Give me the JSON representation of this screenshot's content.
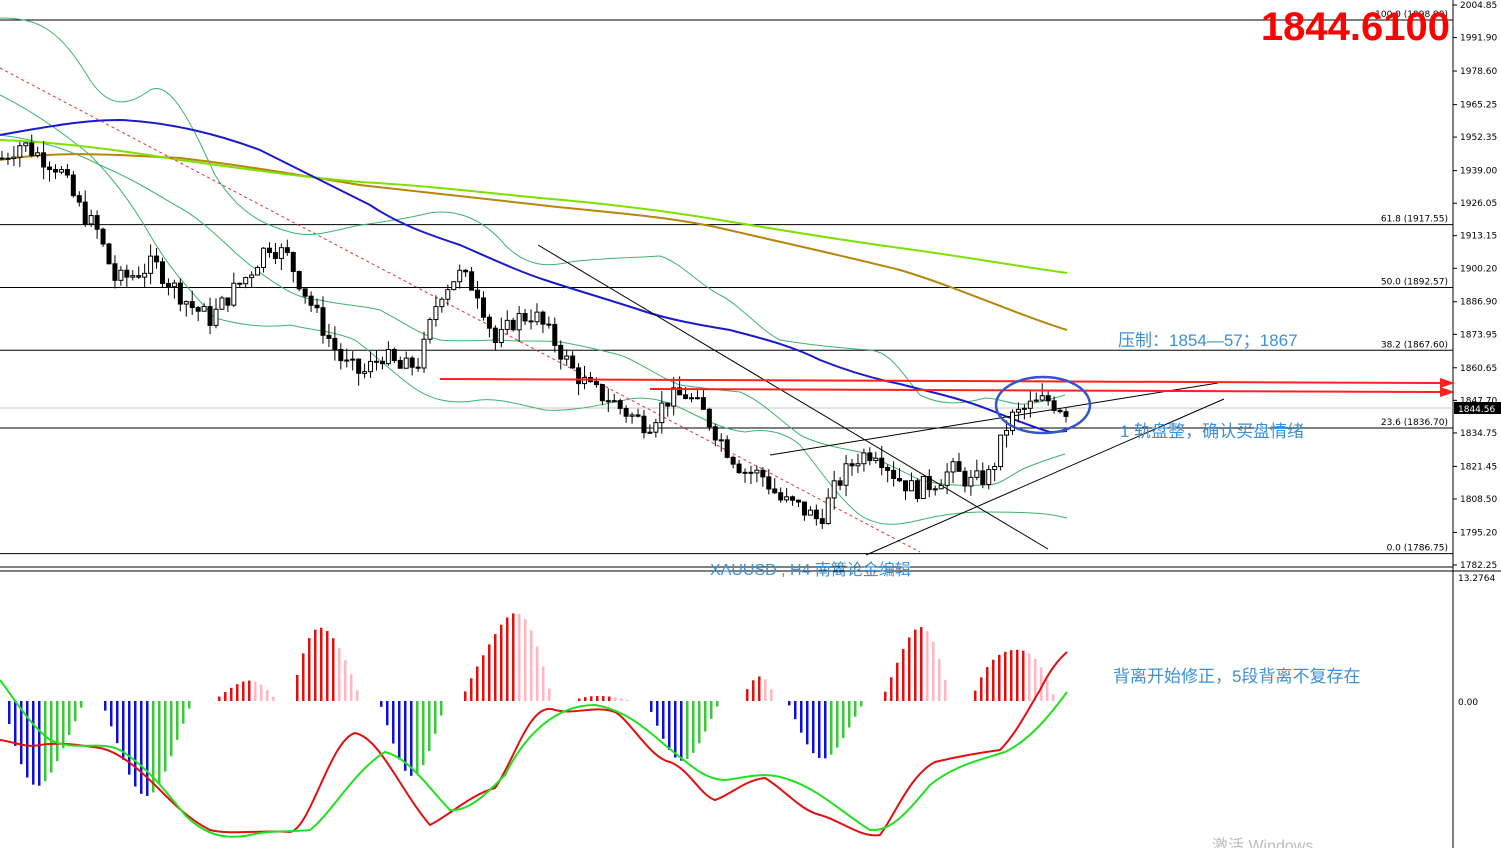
{
  "current_price": "1844.6100",
  "symbol_label": "XAUUSD , H4   南篱论金编辑",
  "annotations": {
    "resistance": "压制：1854—57；1867",
    "consolidation": "1 轨盘整，确认买盘情绪",
    "divergence": "背离开始修正，5段背离不复存在"
  },
  "watermark": "激活 Windows",
  "colors": {
    "bull_candle": "#ffffff",
    "bear_candle": "#000000",
    "ma_blue": "#1a1acd",
    "ma_green": "#7fe000",
    "ma_brown": "#b8860b",
    "bollinger": "#3cb371",
    "resistance_arrow": "#ff2020",
    "highlight_circle": "#3355cc",
    "hist_red": "#e01010",
    "hist_pink": "#ffb6c1",
    "hist_green": "#38c838",
    "hist_blue": "#1010d0",
    "macd_red": "#e01010",
    "macd_green": "#20e020"
  },
  "chart_data": [
    {
      "type": "candlestick",
      "timeframe": "H4",
      "ylim": [
        1780.0,
        2005.0
      ],
      "price_ticks": [
        "2004.85",
        "1991.90",
        "1978.60",
        "1965.25",
        "1952.35",
        "1939.00",
        "1926.05",
        "1913.15",
        "1900.20",
        "1886.90",
        "1873.95",
        "1860.65",
        "1847.70",
        "1834.75",
        "1821.45",
        "1808.50",
        "1795.20",
        "1782.25"
      ],
      "last_price_tag": "1844.56",
      "fibonacci": [
        {
          "label": "100.0 (1998.90)",
          "price": 1998.9
        },
        {
          "label": "61.8 (1917.55)",
          "price": 1917.55
        },
        {
          "label": "50.0 (1892.57)",
          "price": 1892.57
        },
        {
          "label": "38.2 (1867.60)",
          "price": 1867.6
        },
        {
          "label": "23.6 (1836.70)",
          "price": 1836.7
        },
        {
          "label": "0.0 (1786.75)",
          "price": 1786.75
        }
      ],
      "approx_close_path": [
        1944,
        1950,
        1945,
        1940,
        1925,
        1915,
        1895,
        1898,
        1902,
        1893,
        1885,
        1880,
        1890,
        1898,
        1910,
        1905,
        1890,
        1875,
        1862,
        1858,
        1866,
        1860,
        1863,
        1890,
        1898,
        1892,
        1870,
        1880,
        1882,
        1872,
        1860,
        1852,
        1848,
        1842,
        1838,
        1848,
        1850,
        1842,
        1830,
        1820,
        1818,
        1808,
        1805,
        1800,
        1815,
        1825,
        1828,
        1818,
        1812,
        1815,
        1820,
        1815,
        1818,
        1840,
        1845,
        1848,
        1844
      ]
    },
    {
      "type": "macd",
      "ylim_label_top": "13.2764",
      "zero_label": "0.00"
    }
  ]
}
